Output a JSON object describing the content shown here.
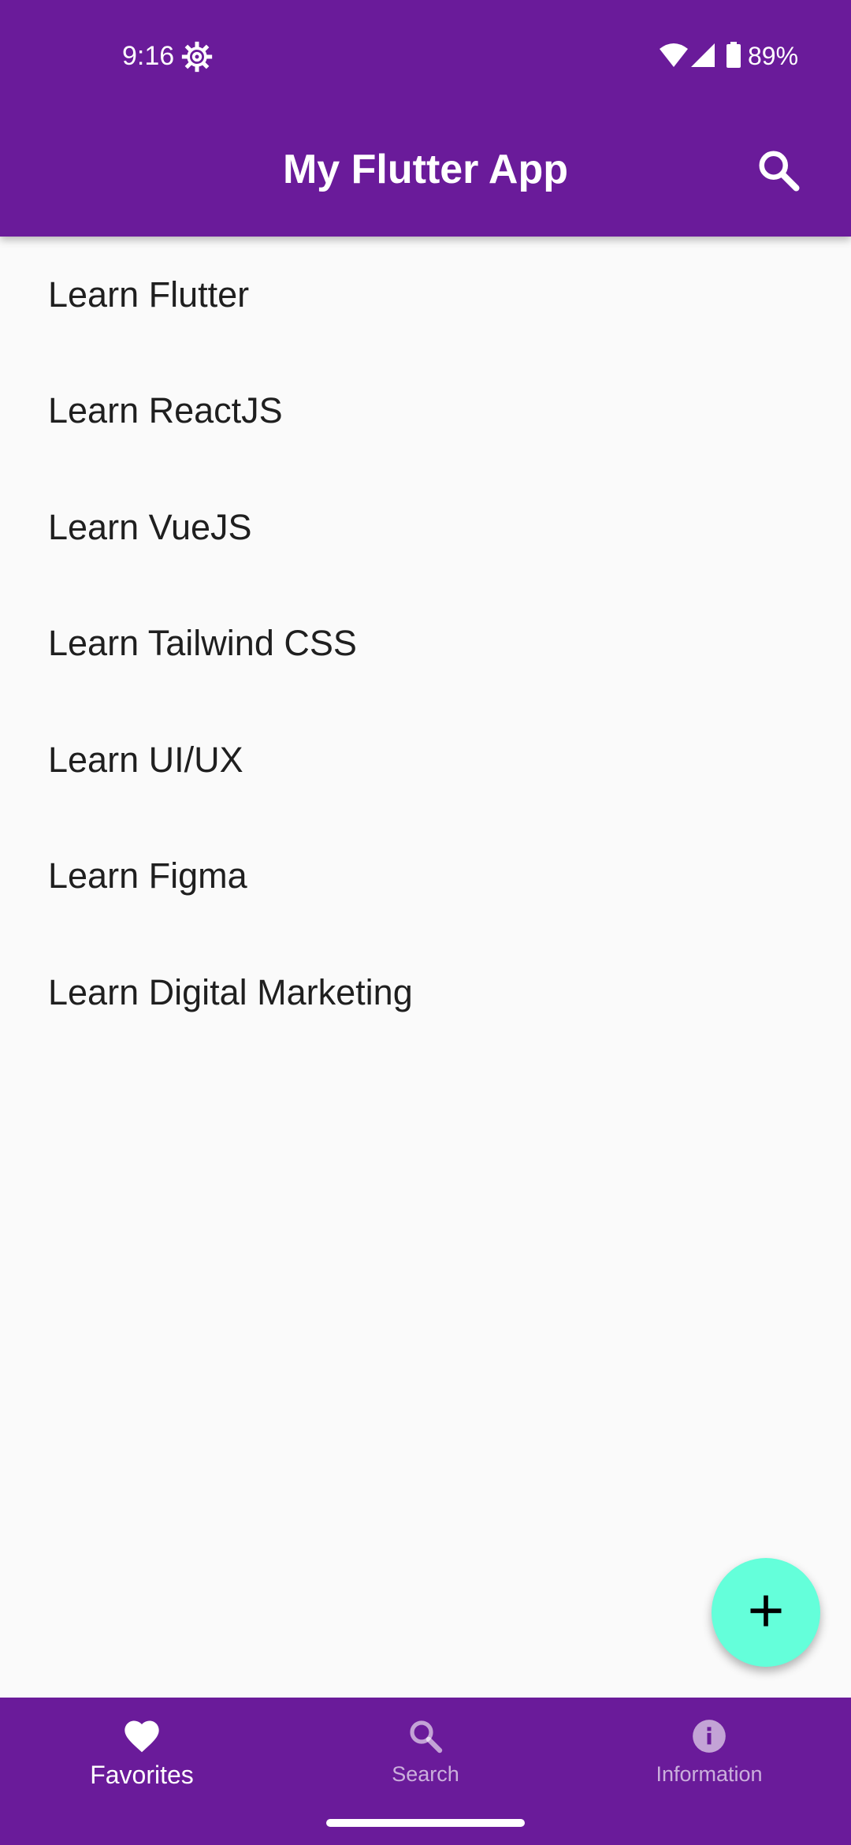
{
  "status_bar": {
    "time": "9:16",
    "battery": "89%",
    "icons": [
      "settings-gear-icon",
      "wifi-icon",
      "cell-signal-icon",
      "battery-icon"
    ]
  },
  "app_bar": {
    "title": "My Flutter App",
    "search_icon": "search-icon"
  },
  "list": {
    "items": [
      {
        "label": "Learn Flutter"
      },
      {
        "label": "Learn ReactJS"
      },
      {
        "label": "Learn VueJS"
      },
      {
        "label": "Learn Tailwind CSS"
      },
      {
        "label": "Learn UI/UX"
      },
      {
        "label": "Learn Figma"
      },
      {
        "label": "Learn Digital Marketing"
      }
    ]
  },
  "fab": {
    "icon": "plus-icon"
  },
  "bottom_nav": {
    "items": [
      {
        "label": "Favorites",
        "icon": "heart-icon",
        "active": true
      },
      {
        "label": "Search",
        "icon": "search-icon",
        "active": false
      },
      {
        "label": "Information",
        "icon": "info-icon",
        "active": false
      }
    ]
  },
  "colors": {
    "primary": "#6a1b9a",
    "accent": "#64ffda",
    "background": "#fafafa",
    "text": "#1f1f1f"
  }
}
